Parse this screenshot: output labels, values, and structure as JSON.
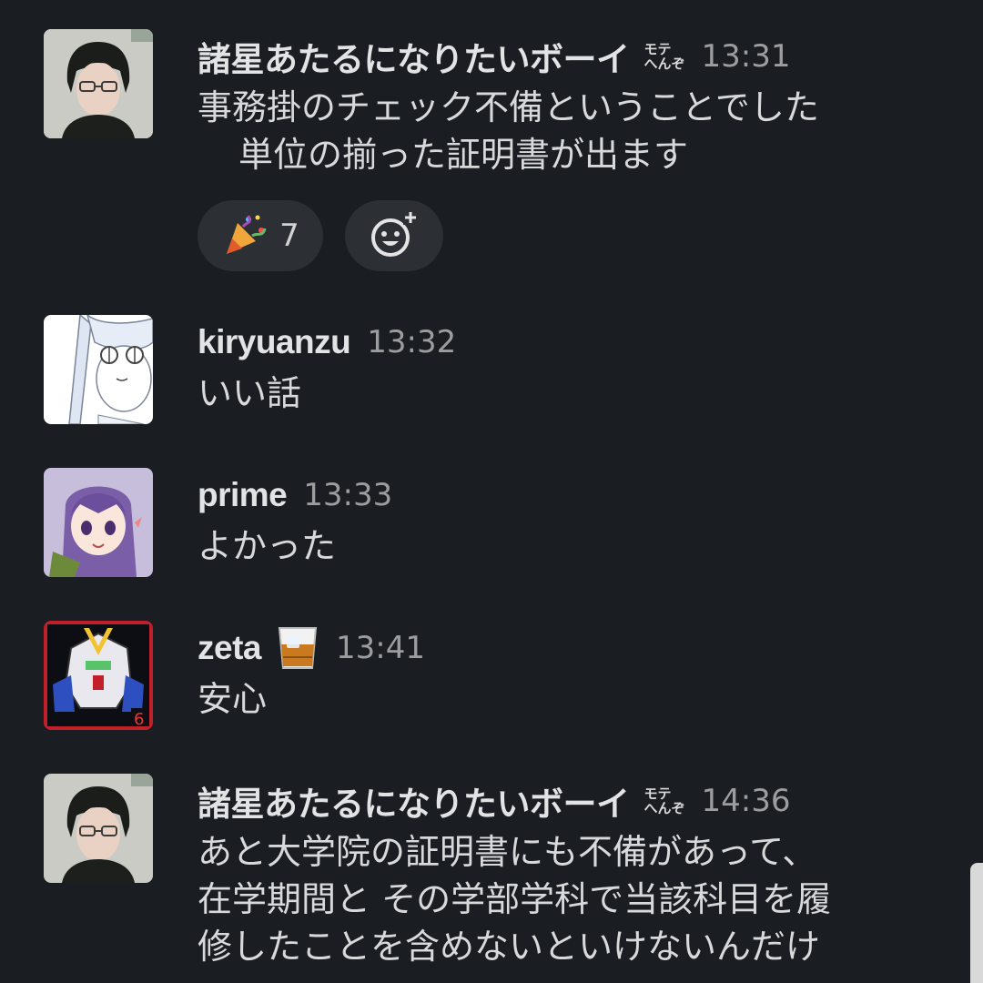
{
  "messages": [
    {
      "name": "諸星あたるになりたいボーイ",
      "status_text": [
        "モテ",
        "へんぞ"
      ],
      "time": "13:31",
      "lines": [
        "事務掛のチェック不備ということでした",
        "単位の揃った証明書が出ます"
      ],
      "reactions": [
        {
          "icon": "party-popper-icon",
          "count": "7"
        }
      ],
      "add_reaction_icon": "add-reaction-icon"
    },
    {
      "name": "kiryuanzu",
      "time": "13:32",
      "lines": [
        "いい話"
      ]
    },
    {
      "name": "prime",
      "time": "13:33",
      "lines": [
        "よかった"
      ]
    },
    {
      "name": "zeta",
      "status_emoji": "whisky-glass-icon",
      "time": "13:41",
      "lines": [
        "安心"
      ]
    },
    {
      "name": "諸星あたるになりたいボーイ",
      "status_text": [
        "モテ",
        "へんぞ"
      ],
      "time": "14:36",
      "lines": [
        "あと大学院の証明書にも不備があって、",
        "在学期間と その学部学科で当該科目を履",
        "修したことを含めないといけないんだけ"
      ]
    }
  ]
}
